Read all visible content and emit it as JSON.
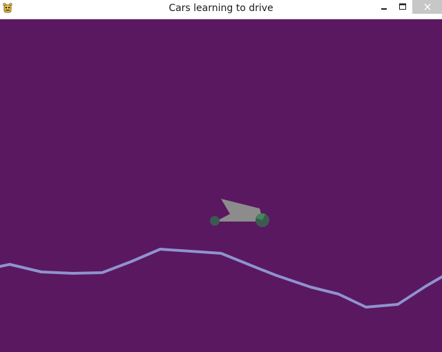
{
  "window": {
    "title": "Cars learning to drive",
    "app_icon": "pygame-snake-icon",
    "controls": {
      "minimize_icon": "minimize-icon",
      "maximize_icon": "maximize-icon",
      "close_icon": "close-icon"
    }
  },
  "colors": {
    "background": "#5a1860",
    "terrain": "#8f93cf",
    "car_body": "#8c8c8c",
    "wheel": "#3c5a50",
    "wheel_highlight": "#3f8a5a"
  }
}
